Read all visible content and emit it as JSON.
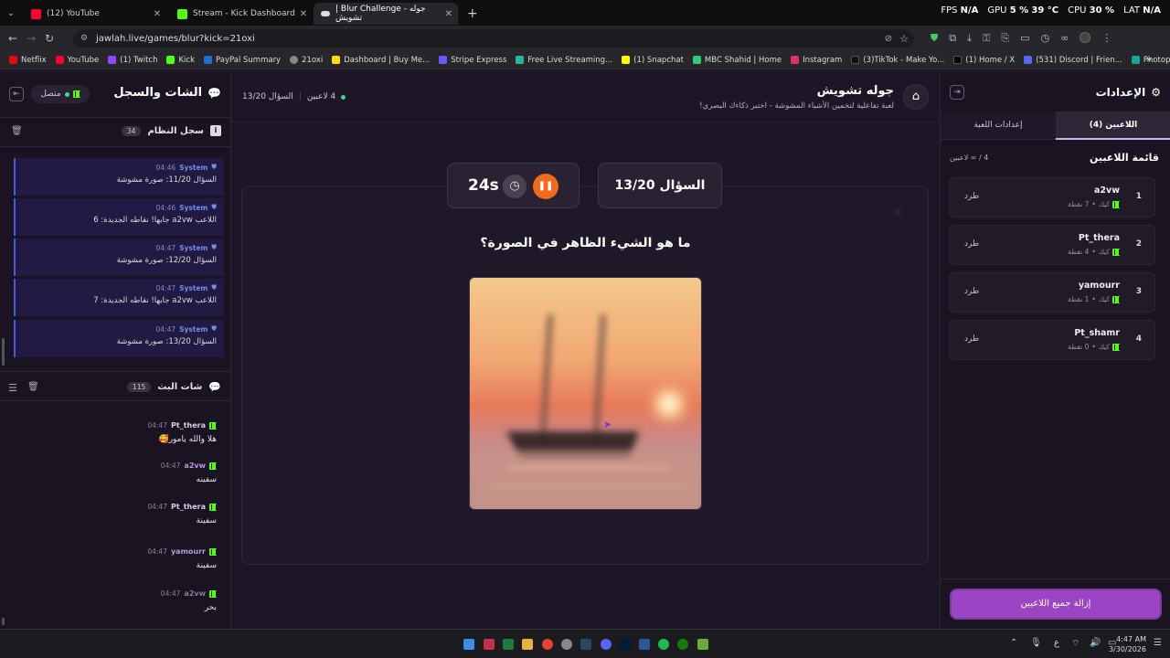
{
  "browser": {
    "tabs": [
      {
        "label": "(12) YouTube",
        "color": "#ff0033"
      },
      {
        "label": "Stream - Kick Dashboard",
        "color": "#53fc18"
      },
      {
        "label": "| Blur Challenge - جوله تشويش",
        "color": "#dddddd"
      }
    ],
    "new_tab": "+",
    "url": "jawlah.live/games/blur?kick=21oxi",
    "bookmarks": [
      "Netflix",
      "YouTube",
      "(1) Twitch",
      "Kick",
      "PayPal Summary",
      "21oxi",
      "Dashboard | Buy Me...",
      "Stripe Express",
      "Free Live Streaming...",
      "(1) Snapchat",
      "MBC Shahid | Home",
      "Instagram",
      "(3)TikTok - Make Yo...",
      "(1) Home / X",
      "(531) Discord | Frien...",
      "Photopea | Online P..."
    ],
    "bookmarks_more": "»",
    "perf": {
      "fps_label": "FPS",
      "fps": "N/A",
      "gpu_label": "GPU",
      "gpu": "5 %",
      "gpu_temp": "39 °C",
      "cpu_label": "CPU",
      "cpu": "30 %",
      "lat_label": "LAT",
      "lat": "N/A"
    }
  },
  "left": {
    "title": "الشات والسجل",
    "status": "متصل",
    "system_log": {
      "title": "سجل النظام",
      "count": "34"
    },
    "logs": [
      {
        "name": "System",
        "time": "04:46",
        "msg": "السؤال 11/20: صورة مشوشة"
      },
      {
        "name": "System",
        "time": "04:46",
        "msg": "اللاعب a2vw جابها! نقاطه الجديدة: 6"
      },
      {
        "name": "System",
        "time": "04:47",
        "msg": "السؤال 12/20: صورة مشوشة"
      },
      {
        "name": "System",
        "time": "04:47",
        "msg": "اللاعب a2vw جابها! نقاطه الجديدة: 7"
      },
      {
        "name": "System",
        "time": "04:47",
        "msg": "السؤال 13/20: صورة مشوشة"
      }
    ],
    "stream_chat": {
      "title": "شات البث",
      "count": "115"
    },
    "chats": [
      {
        "user": "Pt_thera",
        "time": "04:47",
        "text": "هلا والله يامور🥰",
        "color": "#d8cde6"
      },
      {
        "user": "a2vw",
        "time": "04:47",
        "text": "سفينه",
        "color": "#b89ad8"
      },
      {
        "user": "Pt_thera",
        "time": "04:47",
        "text": "سفينة",
        "color": "#d8cde6"
      },
      {
        "user": "yamourr",
        "time": "04:47",
        "text": "سفينة",
        "color": "#b89ad8"
      },
      {
        "user": "a2vw",
        "time": "04:47",
        "text": "بحر",
        "color": "#8a7a9a"
      }
    ]
  },
  "main": {
    "title": "جوله تشويش",
    "subtitle": "لعبة تفاعلية لتخمين الأشياء المشوشة - اختبر ذكاءك البصري!",
    "players_count": "4 لاعبين",
    "question_count": "السؤال 13/20",
    "question_card": "السؤال 13/20",
    "timer": "24s",
    "question": "ما هو الشيء الظاهر في الصورة؟"
  },
  "right": {
    "title": "الإعدادات",
    "tabs": {
      "players": "اللاعبين (4)",
      "settings": "إعدادات اللعبة"
    },
    "list_title": "قائمة اللاعبين",
    "list_count": "4 / ∞ لاعبين",
    "players": [
      {
        "rank": "1",
        "name": "a2vw",
        "platform": "كيك",
        "points": "7 نقطة",
        "action": "طرد"
      },
      {
        "rank": "2",
        "name": "Pt_thera",
        "platform": "كيك",
        "points": "4 نقطة",
        "action": "طرد"
      },
      {
        "rank": "3",
        "name": "yamourr",
        "platform": "كيك",
        "points": "1 نقطة",
        "action": "طرد"
      },
      {
        "rank": "4",
        "name": "Pt_shamr",
        "platform": "كيك",
        "points": "0 نقطة",
        "action": "طرد"
      }
    ],
    "remove_all": "إزالة جميع اللاعبين"
  },
  "taskbar": {
    "time": "4:47 AM",
    "date": "3/30/2026",
    "lang": "ع"
  }
}
